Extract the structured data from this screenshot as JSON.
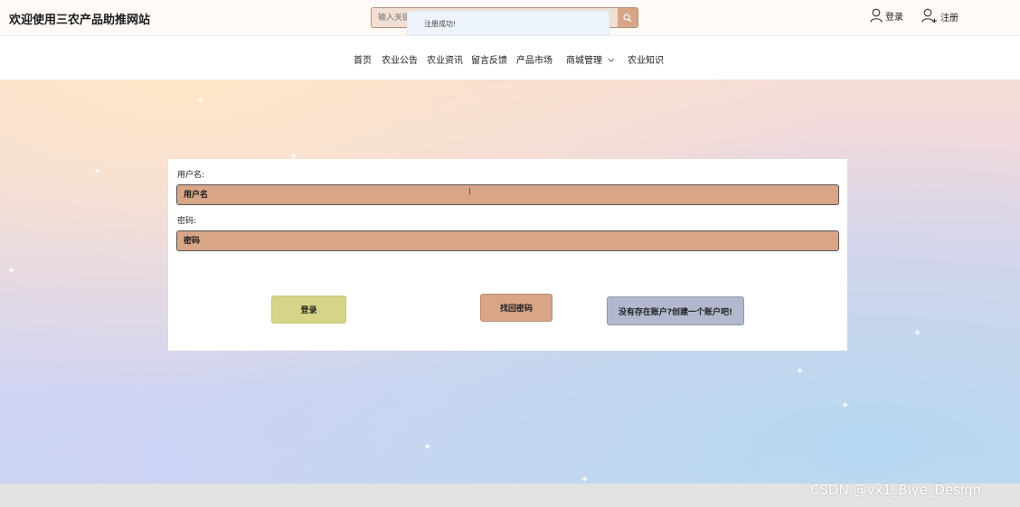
{
  "header": {
    "site_title": "欢迎使用三农产品助推网站",
    "search_placeholder": "输入关键字",
    "login_label": "登录",
    "register_label": "注册"
  },
  "toast": {
    "message": "注册成功!"
  },
  "nav": {
    "items": [
      {
        "label": "首页"
      },
      {
        "label": "农业公告"
      },
      {
        "label": "农业资讯"
      },
      {
        "label": "留言反馈"
      },
      {
        "label": "产品市场"
      },
      {
        "label": "商城管理"
      },
      {
        "label": "农业知识"
      }
    ]
  },
  "form": {
    "username_label": "用户名:",
    "username_placeholder": "用户名",
    "password_label": "密码:",
    "password_placeholder": "密码",
    "login_button": "登录",
    "forgot_button": "找回密码",
    "create_button": "没有存在账户?创建一个账户吧!"
  },
  "watermark": "CSDN @vx1_Biye_Design",
  "colors": {
    "input_bg": "#d8a587",
    "login_btn": "#d5d488",
    "create_btn": "#b2b9cf"
  }
}
